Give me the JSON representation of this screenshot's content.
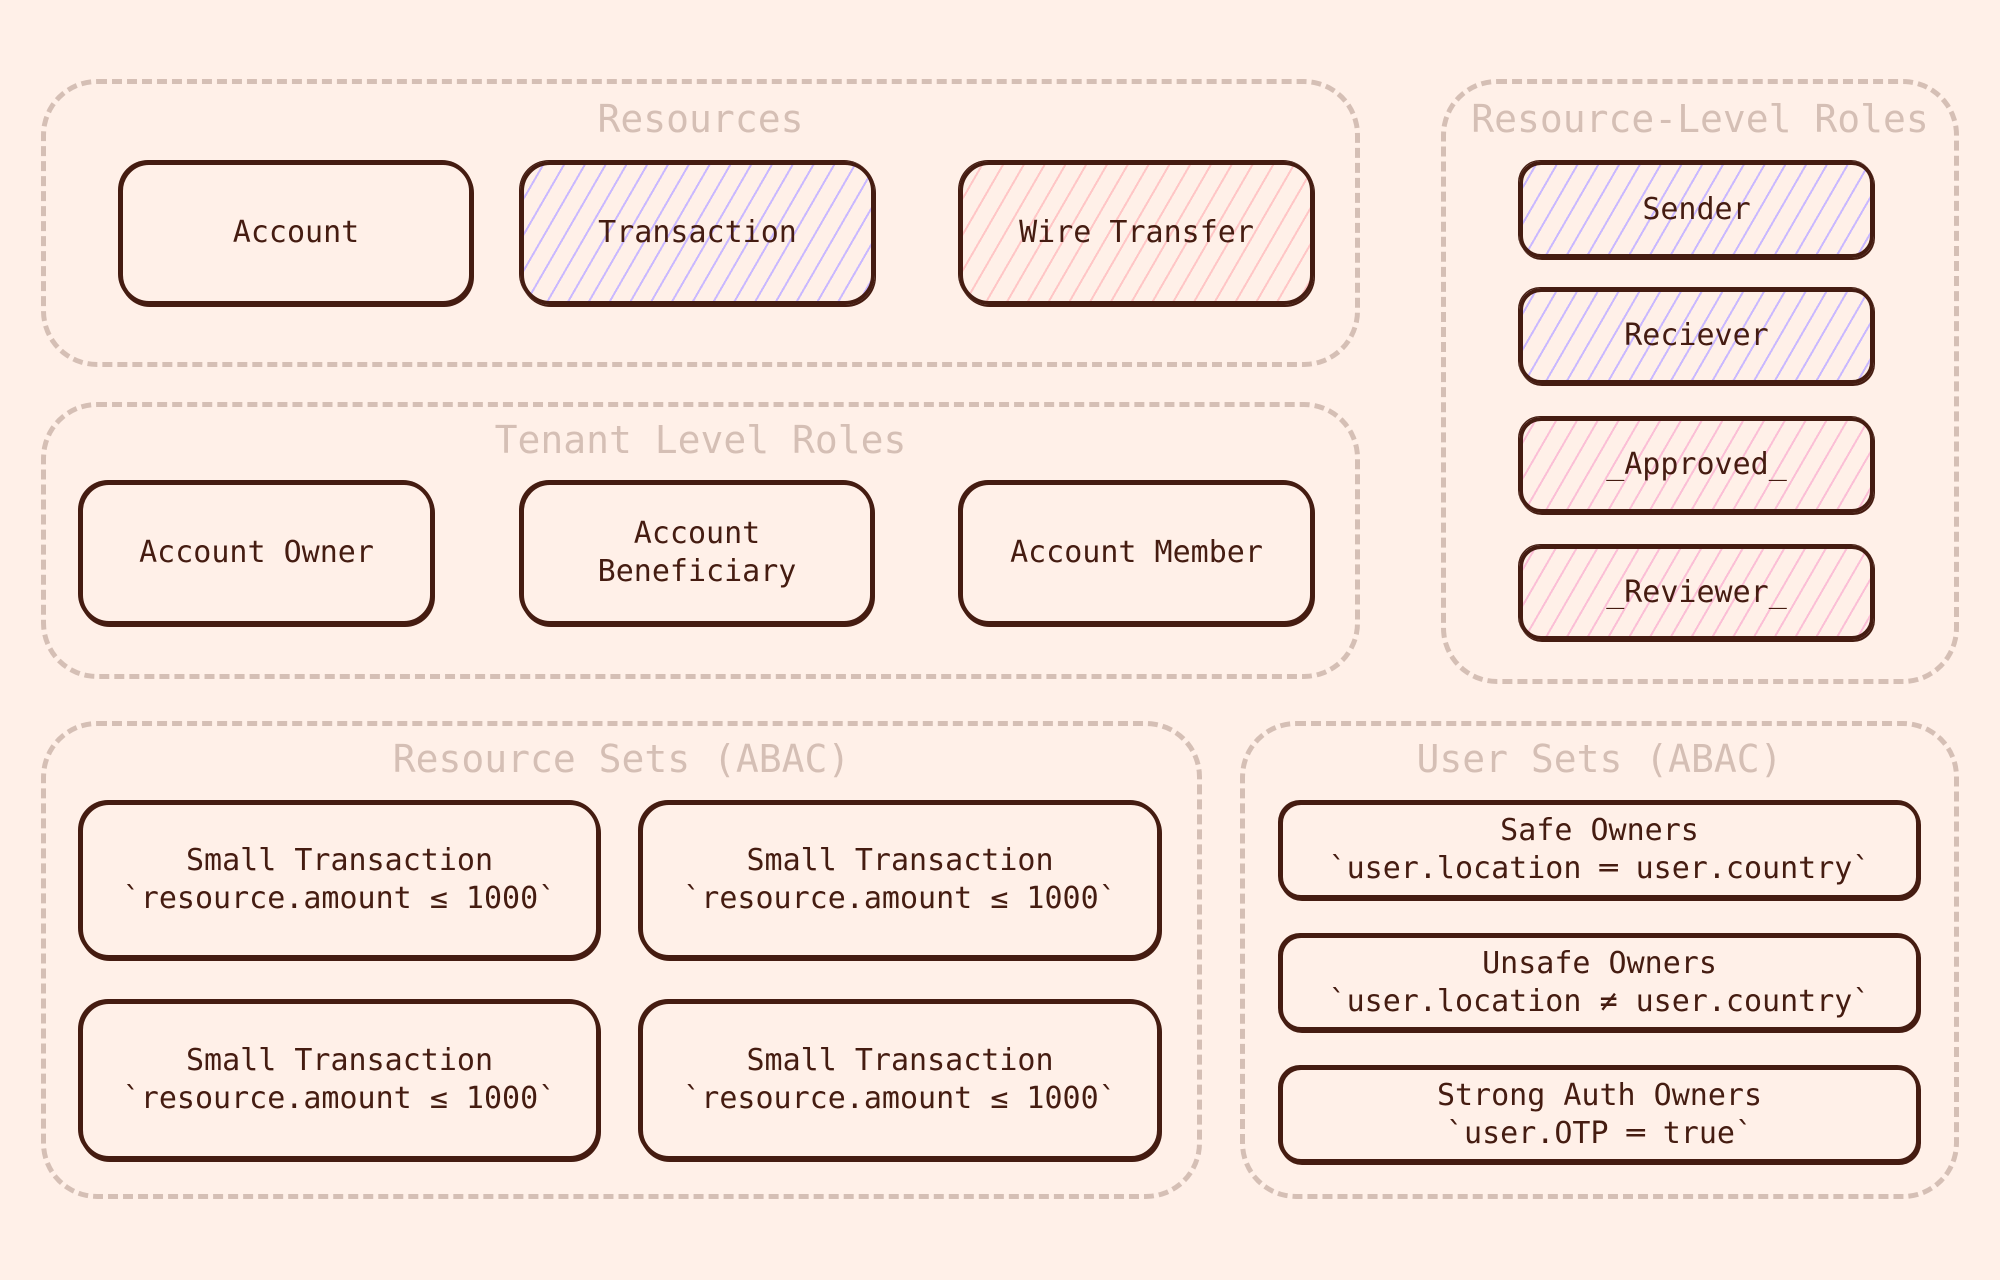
{
  "colors": {
    "background": "#fff0e8",
    "stroke": "#451c11",
    "group_border": "#d5bfb5",
    "hatch_purple": "#c9b8ff",
    "hatch_salmon": "#ffc6c6",
    "hatch_pink": "#fbbfd6"
  },
  "groups": {
    "resources": {
      "title": "Resources",
      "nodes": [
        {
          "label": "Account",
          "fill": "none"
        },
        {
          "label": "Transaction",
          "fill": "purple"
        },
        {
          "label": "Wire Transfer",
          "fill": "salmon"
        }
      ]
    },
    "resource_level_roles": {
      "title": "Resource-Level Roles",
      "nodes": [
        {
          "label": "Sender",
          "fill": "purple"
        },
        {
          "label": "Reciever",
          "fill": "purple"
        },
        {
          "label": "_Approved_",
          "fill": "pink"
        },
        {
          "label": "_Reviewer_",
          "fill": "pink"
        }
      ]
    },
    "tenant_level_roles": {
      "title": "Tenant Level Roles",
      "nodes": [
        {
          "label": "Account Owner"
        },
        {
          "label": "Account\nBeneficiary"
        },
        {
          "label": "Account Member"
        }
      ]
    },
    "resource_sets": {
      "title": "Resource Sets (ABAC)",
      "nodes": [
        {
          "name": "Small Transaction",
          "rule": "`resource.amount ≤ 1000`"
        },
        {
          "name": "Small Transaction",
          "rule": "`resource.amount ≤ 1000`"
        },
        {
          "name": "Small Transaction",
          "rule": "`resource.amount ≤ 1000`"
        },
        {
          "name": "Small Transaction",
          "rule": "`resource.amount ≤ 1000`"
        }
      ]
    },
    "user_sets": {
      "title": "User Sets (ABAC)",
      "nodes": [
        {
          "name": "Safe Owners",
          "rule": "`user.location ═ user.country`"
        },
        {
          "name": "Unsafe Owners",
          "rule": "`user.location ≠ user.country`"
        },
        {
          "name": "Strong Auth Owners",
          "rule": "`user.OTP ═ true`"
        }
      ]
    }
  }
}
